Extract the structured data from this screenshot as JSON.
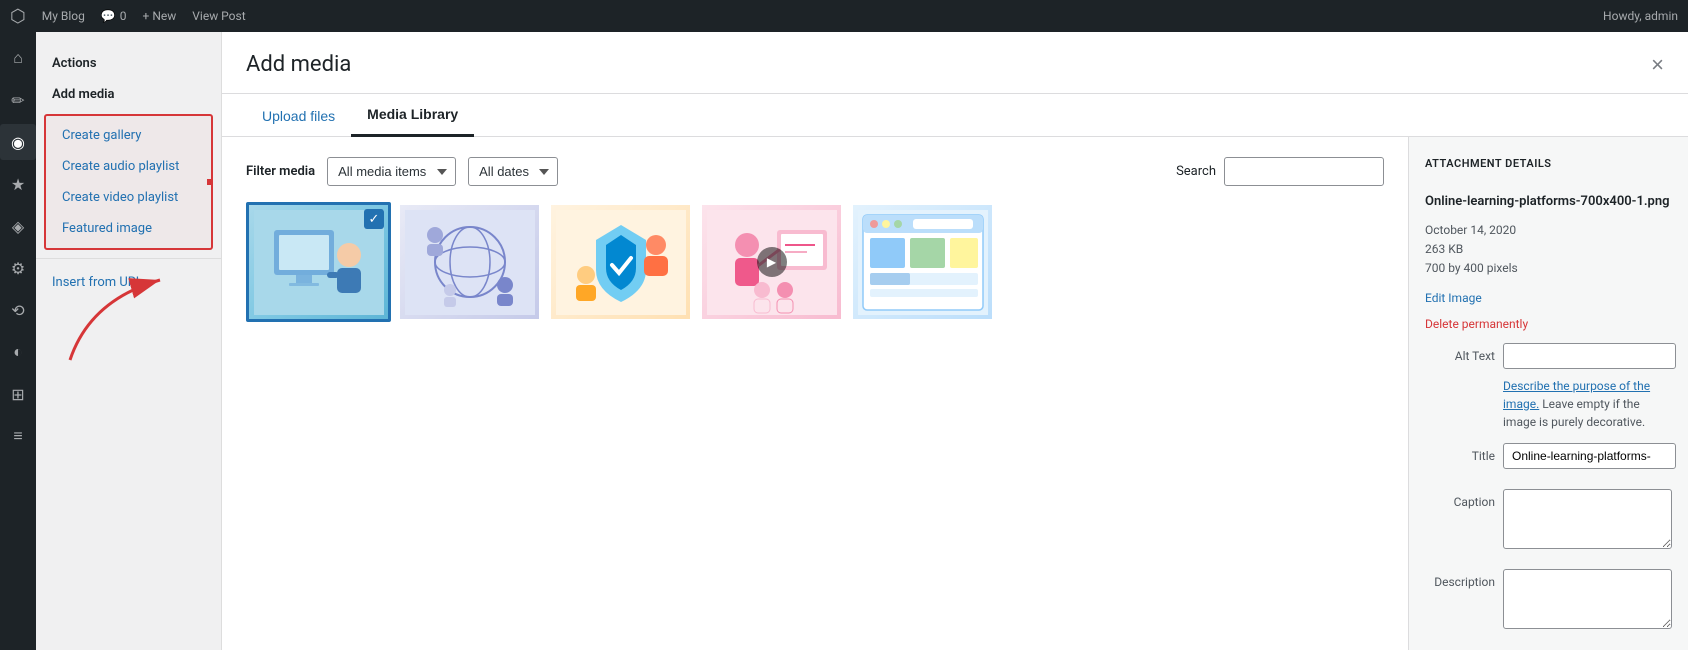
{
  "adminbar": {
    "logo": "W",
    "blog_label": "My Blog",
    "comments_count": "0",
    "new_label": "+ New",
    "view_post_label": "View Post",
    "howdy_label": "Howdy, admin"
  },
  "sidebar": {
    "icons": [
      "⌂",
      "✏",
      "◉",
      "★",
      "◈",
      "⚙",
      "⟲",
      "◐",
      "⊞",
      "≡",
      "✿",
      "⊕",
      "⚑"
    ]
  },
  "left_panel": {
    "actions_label": "Actions",
    "add_media_label": "Add media",
    "create_gallery_label": "Create gallery",
    "create_audio_label": "Create audio playlist",
    "create_video_label": "Create video playlist",
    "featured_image_label": "Featured image",
    "insert_url_label": "Insert from URL"
  },
  "dialog": {
    "title": "Add media",
    "close_label": "×",
    "tabs": [
      {
        "id": "upload",
        "label": "Upload files",
        "active": false
      },
      {
        "id": "library",
        "label": "Media Library",
        "active": true
      }
    ]
  },
  "filter": {
    "label": "Filter media",
    "media_type_label": "All media items",
    "dates_label": "All dates",
    "search_label": "Search",
    "search_placeholder": ""
  },
  "media_items": [
    {
      "id": 1,
      "alt": "Online learning platform illustration",
      "type": "image",
      "selected": true,
      "bg": "thumb-1"
    },
    {
      "id": 2,
      "alt": "Network globe illustration",
      "type": "image",
      "selected": false,
      "bg": "thumb-2"
    },
    {
      "id": 3,
      "alt": "Security shield illustration",
      "type": "image",
      "selected": false,
      "bg": "thumb-3"
    },
    {
      "id": 4,
      "alt": "Woman presenting illustration",
      "type": "image",
      "selected": false,
      "bg": "thumb-4",
      "has_play": true
    },
    {
      "id": 5,
      "alt": "Dashboard screenshot",
      "type": "image",
      "selected": false,
      "bg": "thumb-5"
    }
  ],
  "attachment_details": {
    "section_title": "ATTACHMENT DETAILS",
    "filename": "Online-learning-platforms-700x400-1.png",
    "date": "October 14, 2020",
    "filesize": "263 KB",
    "dimensions": "700 by 400 pixels",
    "edit_label": "Edit Image",
    "delete_label": "Delete permanently",
    "alt_text_label": "Alt Text",
    "alt_text_value": "",
    "alt_hint_link": "Describe the purpose of the image.",
    "alt_hint_text": " Leave empty if the image is purely decorative.",
    "title_label": "Title",
    "title_value": "Online-learning-platforms-",
    "caption_label": "Caption",
    "caption_value": "",
    "description_label": "Description",
    "description_value": ""
  }
}
